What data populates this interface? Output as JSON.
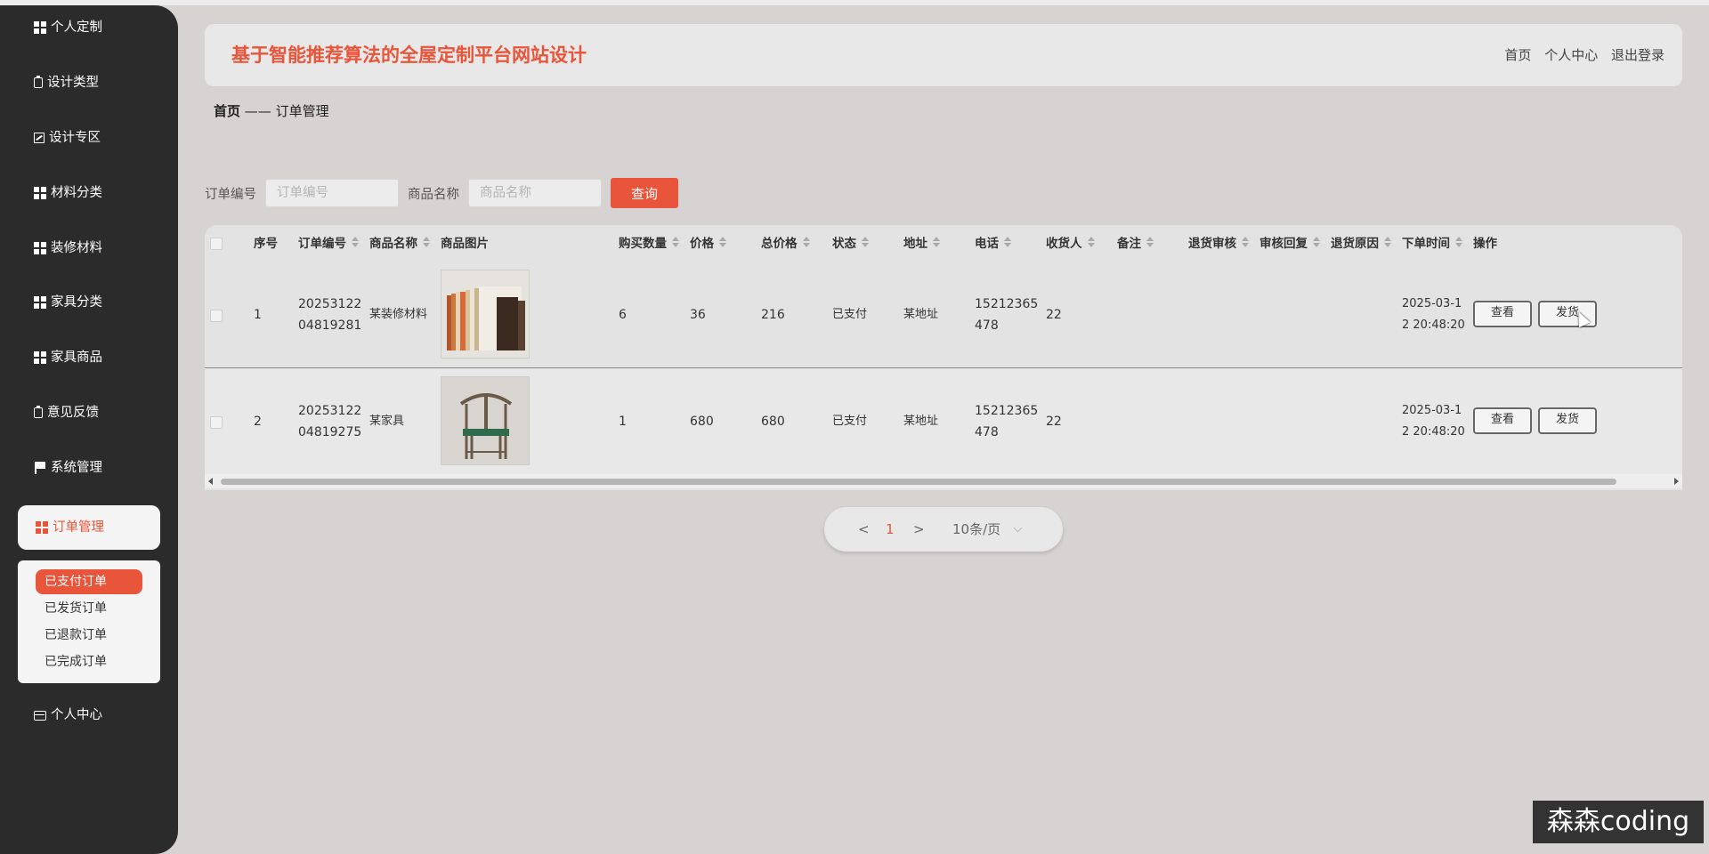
{
  "app": {
    "title": "基于智能推荐算法的全屋定制平台网站设计"
  },
  "header": {
    "links": [
      "首页",
      "个人中心",
      "退出登录"
    ]
  },
  "sidebar": {
    "items": [
      {
        "label": "个人定制",
        "icon": "grid-icon"
      },
      {
        "label": "设计类型",
        "icon": "clipboard-icon"
      },
      {
        "label": "设计专区",
        "icon": "chart-icon"
      },
      {
        "label": "材料分类",
        "icon": "grid-icon"
      },
      {
        "label": "装修材料",
        "icon": "grid-icon"
      },
      {
        "label": "家具分类",
        "icon": "grid-icon"
      },
      {
        "label": "家具商品",
        "icon": "grid-icon"
      },
      {
        "label": "意见反馈",
        "icon": "clipboard-icon"
      },
      {
        "label": "系统管理",
        "icon": "flag-icon"
      }
    ],
    "active": {
      "label": "订单管理",
      "icon": "grid-icon"
    },
    "submenu": [
      "已支付订单",
      "已发货订单",
      "已退款订单",
      "已完成订单"
    ],
    "submenu_active": "已支付订单",
    "footer": {
      "label": "个人中心",
      "icon": "card-icon"
    }
  },
  "breadcrumb": {
    "home": "首页",
    "separator": "——",
    "current": "订单管理"
  },
  "search": {
    "order_label": "订单编号",
    "order_placeholder": "订单编号",
    "product_label": "商品名称",
    "product_placeholder": "商品名称",
    "query_button": "查询"
  },
  "table": {
    "headers": [
      "序号",
      "订单编号",
      "商品名称",
      "商品图片",
      "购买数量",
      "价格",
      "总价格",
      "状态",
      "地址",
      "电话",
      "收货人",
      "备注",
      "退货审核",
      "审核回复",
      "退货原因",
      "下单时间",
      "操作"
    ],
    "rows": [
      {
        "index": "1",
        "order_no": "2025312204819281",
        "product": "某装修材料",
        "qty": "6",
        "price": "36",
        "total": "216",
        "status": "已支付",
        "address": "某地址",
        "phone": "15212365478",
        "receiver": "22",
        "time": "2025-03-12 20:48:20",
        "picture": "books-image"
      },
      {
        "index": "2",
        "order_no": "2025312204819275",
        "product": "某家具",
        "qty": "1",
        "price": "680",
        "total": "680",
        "status": "已支付",
        "address": "某地址",
        "phone": "15212365478",
        "receiver": "22",
        "time": "2025-03-12 20:48:20",
        "picture": "chair-image"
      }
    ],
    "actions": {
      "view": "查看",
      "ship": "发货"
    }
  },
  "pagination": {
    "prev": "<",
    "current": "1",
    "next": ">",
    "page_size": "10条/页"
  },
  "watermark": "森森coding",
  "colors": {
    "accent": "#e8553a",
    "sidebar": "#2b2b2b"
  }
}
